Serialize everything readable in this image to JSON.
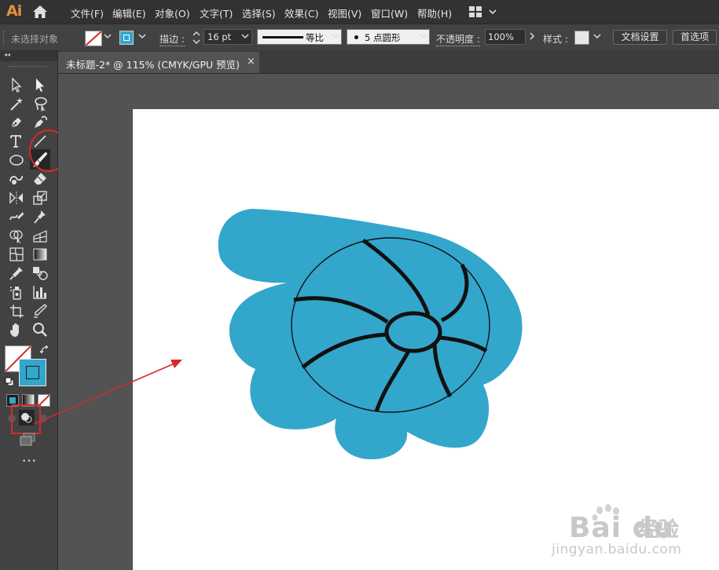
{
  "app": {
    "logo": "Ai"
  },
  "menu": {
    "items": [
      "文件(F)",
      "编辑(E)",
      "对象(O)",
      "文字(T)",
      "选择(S)",
      "效果(C)",
      "视图(V)",
      "窗口(W)",
      "帮助(H)"
    ]
  },
  "control_bar": {
    "selection_status": "未选择对象",
    "stroke_label": "描边 :",
    "stroke_weight": "16 pt",
    "variable_width_label": "等比",
    "brush_label": "5 点圆形",
    "opacity_label": "不透明度 :",
    "opacity_value": "100%",
    "style_label": "样式 :",
    "document_setup_button": "文档设置",
    "preferences_button": "首选项"
  },
  "document": {
    "tab_title": "未标题-2* @ 115% (CMYK/GPU 预览)",
    "close_glyph": "×"
  },
  "tool_panel": {
    "collapse_glyph": "◂◂",
    "more_tools_glyph": "•••"
  },
  "colors": {
    "fill_color": "#33a6cc",
    "artwork_blue": "#33a6cc",
    "annotation_red": "#d42a2a",
    "app_logo": "#e8903a"
  },
  "watermark": {
    "brand": "Bai du",
    "brand_cn": "经验",
    "url": "jingyan.baidu.com"
  },
  "icons": [
    "home-icon",
    "workspace-switcher-icon",
    "selection-tool-icon",
    "direct-selection-tool-icon",
    "magic-wand-tool-icon",
    "lasso-tool-icon",
    "pen-tool-icon",
    "curvature-tool-icon",
    "type-tool-icon",
    "line-segment-tool-icon",
    "ellipse-tool-icon",
    "paintbrush-tool-icon",
    "shaper-tool-icon",
    "eraser-tool-icon",
    "rotate-tool-icon",
    "scale-tool-icon",
    "warp-tool-icon",
    "puppet-warp-tool-icon",
    "shape-builder-tool-icon",
    "perspective-grid-tool-icon",
    "mesh-tool-icon",
    "gradient-tool-icon",
    "eyedropper-tool-icon",
    "blend-tool-icon",
    "symbol-sprayer-tool-icon",
    "column-graph-tool-icon",
    "artboard-tool-icon",
    "slice-tool-icon",
    "hand-tool-icon",
    "zoom-tool-icon",
    "swap-fill-stroke-icon",
    "default-colors-icon",
    "color-mode-icon",
    "gradient-mode-icon",
    "none-mode-icon",
    "draw-normal-icon",
    "draw-behind-icon",
    "draw-inside-icon",
    "screen-mode-icon",
    "more-tools-icon",
    "close-icon"
  ]
}
